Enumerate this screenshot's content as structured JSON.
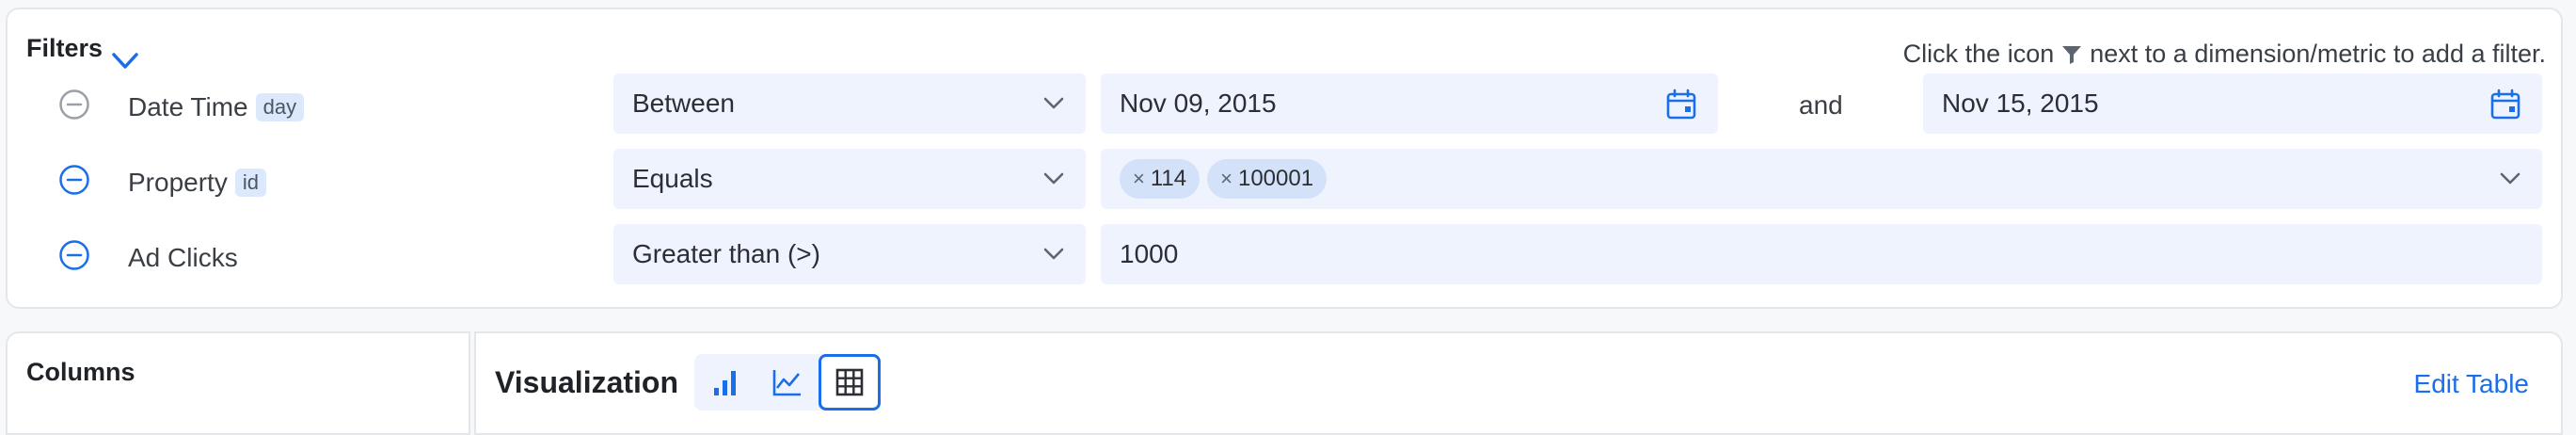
{
  "filters": {
    "title": "Filters",
    "hint_before": "Click the icon",
    "hint_after": "next to a dimension/metric to add a filter.",
    "rows": [
      {
        "label": "Date Time",
        "tag": "day",
        "operator": "Between",
        "start_date": "Nov 09, 2015",
        "and_label": "and",
        "end_date": "Nov 15, 2015"
      },
      {
        "label": "Property",
        "tag": "id",
        "operator": "Equals",
        "values": [
          "114",
          "100001"
        ]
      },
      {
        "label": "Ad Clicks",
        "operator": "Greater than (>)",
        "value": "1000"
      }
    ]
  },
  "columns": {
    "title": "Columns"
  },
  "visualization": {
    "title": "Visualization",
    "selected": "table",
    "edit_label": "Edit Table"
  },
  "colors": {
    "accent": "#1a6ee8",
    "field_bg": "#eef3fd",
    "chip_bg": "#d3e1f9",
    "muted_icon": "#9aa0a6"
  }
}
